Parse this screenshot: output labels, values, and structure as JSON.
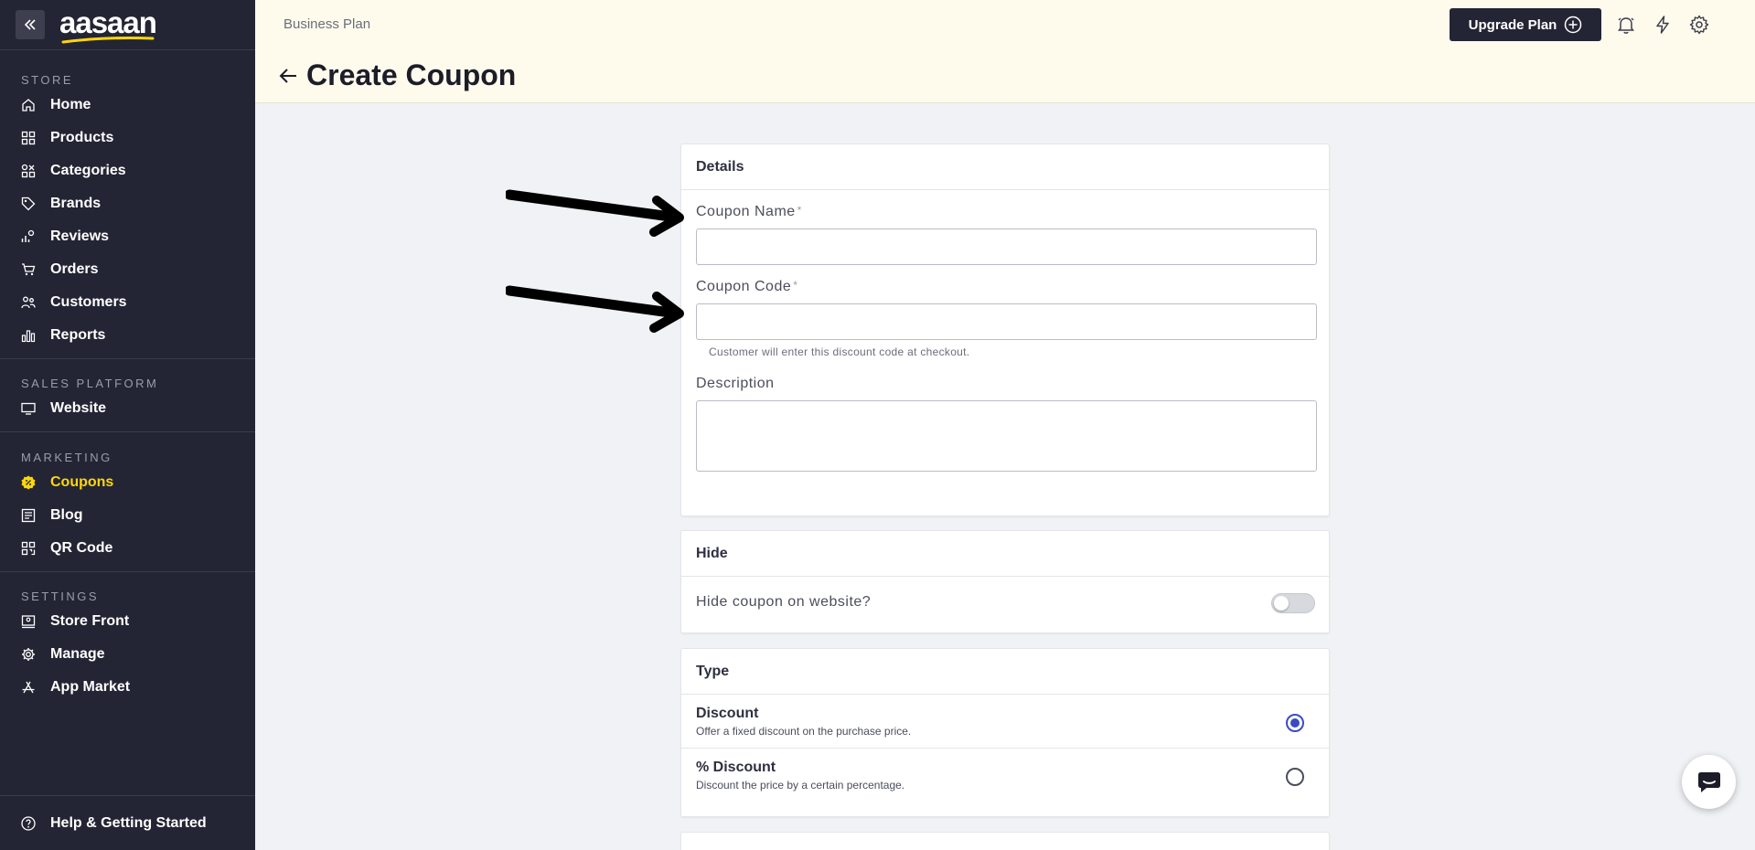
{
  "sidebar": {
    "logo": "aasaan",
    "sections": {
      "store": "STORE",
      "sales_platform": "SALES PLATFORM",
      "marketing": "MARKETING",
      "settings": "SETTINGS"
    },
    "store_items": [
      {
        "label": "Home",
        "icon": "home-icon"
      },
      {
        "label": "Products",
        "icon": "grid-icon"
      },
      {
        "label": "Categories",
        "icon": "categories-icon"
      },
      {
        "label": "Brands",
        "icon": "tag-icon"
      },
      {
        "label": "Reviews",
        "icon": "reviews-icon"
      },
      {
        "label": "Orders",
        "icon": "cart-icon"
      },
      {
        "label": "Customers",
        "icon": "users-icon"
      },
      {
        "label": "Reports",
        "icon": "bar-chart-icon"
      }
    ],
    "sales_items": [
      {
        "label": "Website",
        "icon": "monitor-icon"
      }
    ],
    "marketing_items": [
      {
        "label": "Coupons",
        "icon": "coupon-icon",
        "active": true
      },
      {
        "label": "Blog",
        "icon": "blog-icon"
      },
      {
        "label": "QR Code",
        "icon": "qr-code-icon"
      }
    ],
    "settings_items": [
      {
        "label": "Store Front",
        "icon": "store-front-icon"
      },
      {
        "label": "Manage",
        "icon": "gear-icon"
      },
      {
        "label": "App Market",
        "icon": "app-market-icon"
      }
    ],
    "help": "Help & Getting Started",
    "active_color": "#ffd60a",
    "bg_color": "#232534"
  },
  "header": {
    "plan": "Business Plan",
    "title": "Create Coupon",
    "upgrade_label": "Upgrade Plan",
    "bg_color": "#fefbed"
  },
  "details": {
    "heading": "Details",
    "coupon_name_label": "Coupon Name",
    "coupon_name_value": "",
    "coupon_code_label": "Coupon Code",
    "coupon_code_value": "",
    "coupon_code_hint": "Customer will enter this discount code at checkout.",
    "description_label": "Description",
    "description_value": "",
    "required_mark": "*"
  },
  "hide": {
    "heading": "Hide",
    "label": "Hide coupon on website?",
    "enabled": false
  },
  "type": {
    "heading": "Type",
    "options": [
      {
        "title": "Discount",
        "sub": "Offer a fixed discount on the purchase price.",
        "selected": true
      },
      {
        "title": "% Discount",
        "sub": "Discount the price by a certain percentage.",
        "selected": false
      }
    ],
    "accent_color": "#3b4cc0"
  }
}
